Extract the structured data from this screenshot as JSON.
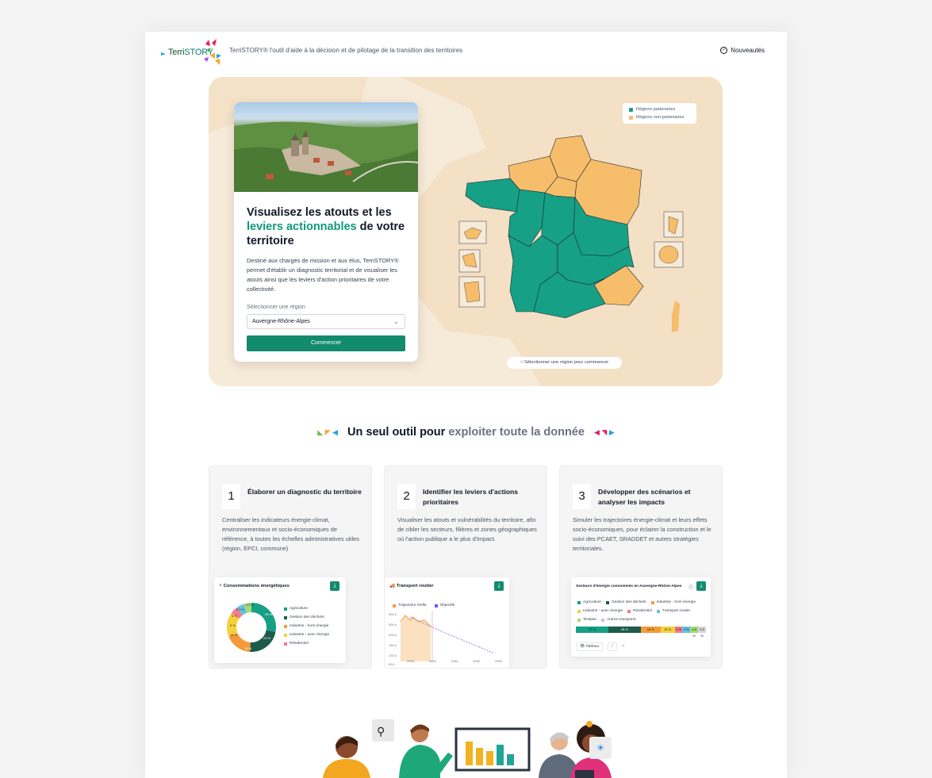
{
  "header": {
    "logo_text_a": "Terri",
    "logo_text_b": "STORY",
    "tagline": "TerriSTORY® l'outil d'aide à la décision et de pilotage de la transition des territoires",
    "news_label": "Nouveautés",
    "news_icon": "check-circle-icon"
  },
  "hero": {
    "title_a": "Visualisez les atouts et les",
    "title_highlight": "leviers actionnables",
    "title_b": "de votre territoire",
    "description": "Destiné aux chargés de mission et aux élus, TerriSTORY® permet d'établir un diagnostic territorial et de visualiser les atouts ainsi que les leviers d'action prioritaires de votre collectivité.",
    "select_label": "Sélectionner une région",
    "select_value": "Auvergne-Rhône-Alpes",
    "start_button": "Commencer",
    "legend": {
      "partner": "Régions partenaires",
      "non_partner": "Régions non-partenaires"
    },
    "map_hint": "Sélectionner une région pour commencer",
    "colors": {
      "partner": "#16a085",
      "non_partner": "#f6bd6a",
      "accent": "#128a6c"
    }
  },
  "section": {
    "title_a": "Un seul outil pour",
    "title_b": "exploiter toute la donnée"
  },
  "steps": [
    {
      "num": "1",
      "title": "Élaborer un diagnostic du territoire",
      "desc": "Centraliser les indicateurs énergie-climat, environnementaux et socio-économiques de référence, à toutes les échelles administratives utiles (région, EPCI, commune)"
    },
    {
      "num": "2",
      "title": "Identifier les leviers d'actions prioritaires",
      "desc": "Visualiser les atouts et vulnérabilités du territoire, afin de cibler les secteurs, filières et zones géographiques où l'action publique a le plus d'impact."
    },
    {
      "num": "3",
      "title": "Développer des scénarios et analyser les impacts",
      "desc": "Simuler les trajectoires énergie-climat et leurs effets socio-économiques, pour éclairer la construction et le suivi des PCAET, SRADDET et autres stratégies territoriales."
    }
  ],
  "mini1": {
    "title": "Consommations énergétiques",
    "legend": [
      "Agriculture",
      "Gestion des déchets",
      "Industrie - hors énergie",
      "Industrie - avec énergie",
      "Résidentiel"
    ],
    "donut_labels": [
      "28 %",
      "23 %",
      "18 %",
      "16 %",
      "5 %",
      "5 %",
      "3.5 %",
      "2.5 %"
    ]
  },
  "mini2": {
    "title": "Transport routier",
    "legend": [
      "Trajectoire réelle",
      "Objectifs"
    ],
    "y_ticks": [
      "400 k",
      "300 k",
      "200 k",
      "150 k",
      "100 k",
      "50 k"
    ],
    "x_ticks": [
      "2018",
      "2026",
      "2034",
      "2042",
      "2050"
    ]
  },
  "mini3": {
    "title": "Secteurs d'énergie consommés en Auvergne-Rhône-Alpes",
    "legend": [
      "Agriculture",
      "Gestion des déchets",
      "Industrie - hors énergie",
      "Industrie - avec énergie",
      "Résidentiel",
      "Transport routier",
      "Tertiaire",
      "Autres transports"
    ],
    "bar_labels": [
      "27 %",
      "28 %",
      "16 %",
      "12 %",
      "5 %",
      "4 %",
      "4.5 %",
      "3.5 %"
    ],
    "table_btn": "Tableau"
  }
}
